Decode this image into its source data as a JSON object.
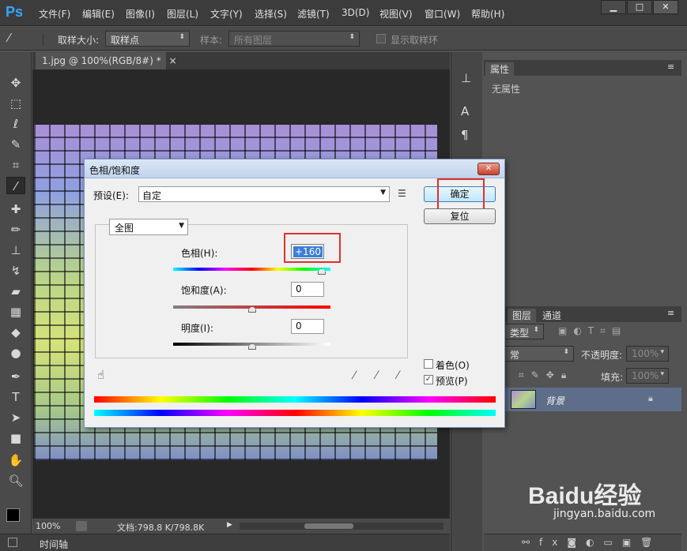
{
  "app": {
    "logo": "Ps"
  },
  "menu": [
    "文件(F)",
    "编辑(E)",
    "图像(I)",
    "图层(L)",
    "文字(Y)",
    "选择(S)",
    "滤镜(T)",
    "3D(D)",
    "视图(V)",
    "窗口(W)",
    "帮助(H)"
  ],
  "window_controls": {
    "minimize": "▁",
    "maximize": "□",
    "close": "✕"
  },
  "options_bar": {
    "sample_size_label": "取样大小:",
    "sample_size_value": "取样点",
    "sample_label": "样本:",
    "sample_value": "所有图层",
    "show_ring_label": "显示取样环"
  },
  "document": {
    "tab_title": "1.jpg @ 100%(RGB/8#) *",
    "tab_close": "×"
  },
  "status": {
    "zoom": "100%",
    "doc_info": "文档:798.8 K/798.8K"
  },
  "timeline": {
    "label": "时间轴"
  },
  "properties_panel": {
    "tab": "属性",
    "content": "无属性"
  },
  "layers_panel": {
    "tabs": [
      "图层",
      "通道"
    ],
    "filter_label": "类型",
    "blend_mode": "常",
    "opacity_label": "不透明度:",
    "opacity_value": "100%",
    "fill_label": "填充:",
    "fill_value": "100%",
    "layer_name": "背景"
  },
  "dialog": {
    "title": "色相/饱和度",
    "preset_label": "预设(E):",
    "preset_value": "自定",
    "ok_label": "确定",
    "reset_label": "复位",
    "channel_value": "全图",
    "hue_label": "色相(H):",
    "hue_value": "+160",
    "hue_level": 160,
    "saturation_label": "饱和度(A):",
    "saturation_value": "0",
    "lightness_label": "明度(I):",
    "lightness_value": "0",
    "colorize_label": "着色(O)",
    "colorize_checked": false,
    "preview_label": "预览(P)",
    "preview_checked": true
  },
  "watermark": {
    "brand": "Baidu经验",
    "url": "jingyan.baidu.com"
  },
  "colors": {
    "highlight_red": "#e0312a",
    "selection_blue": "#3b7ed6",
    "ps_blue": "#31a8ff"
  }
}
